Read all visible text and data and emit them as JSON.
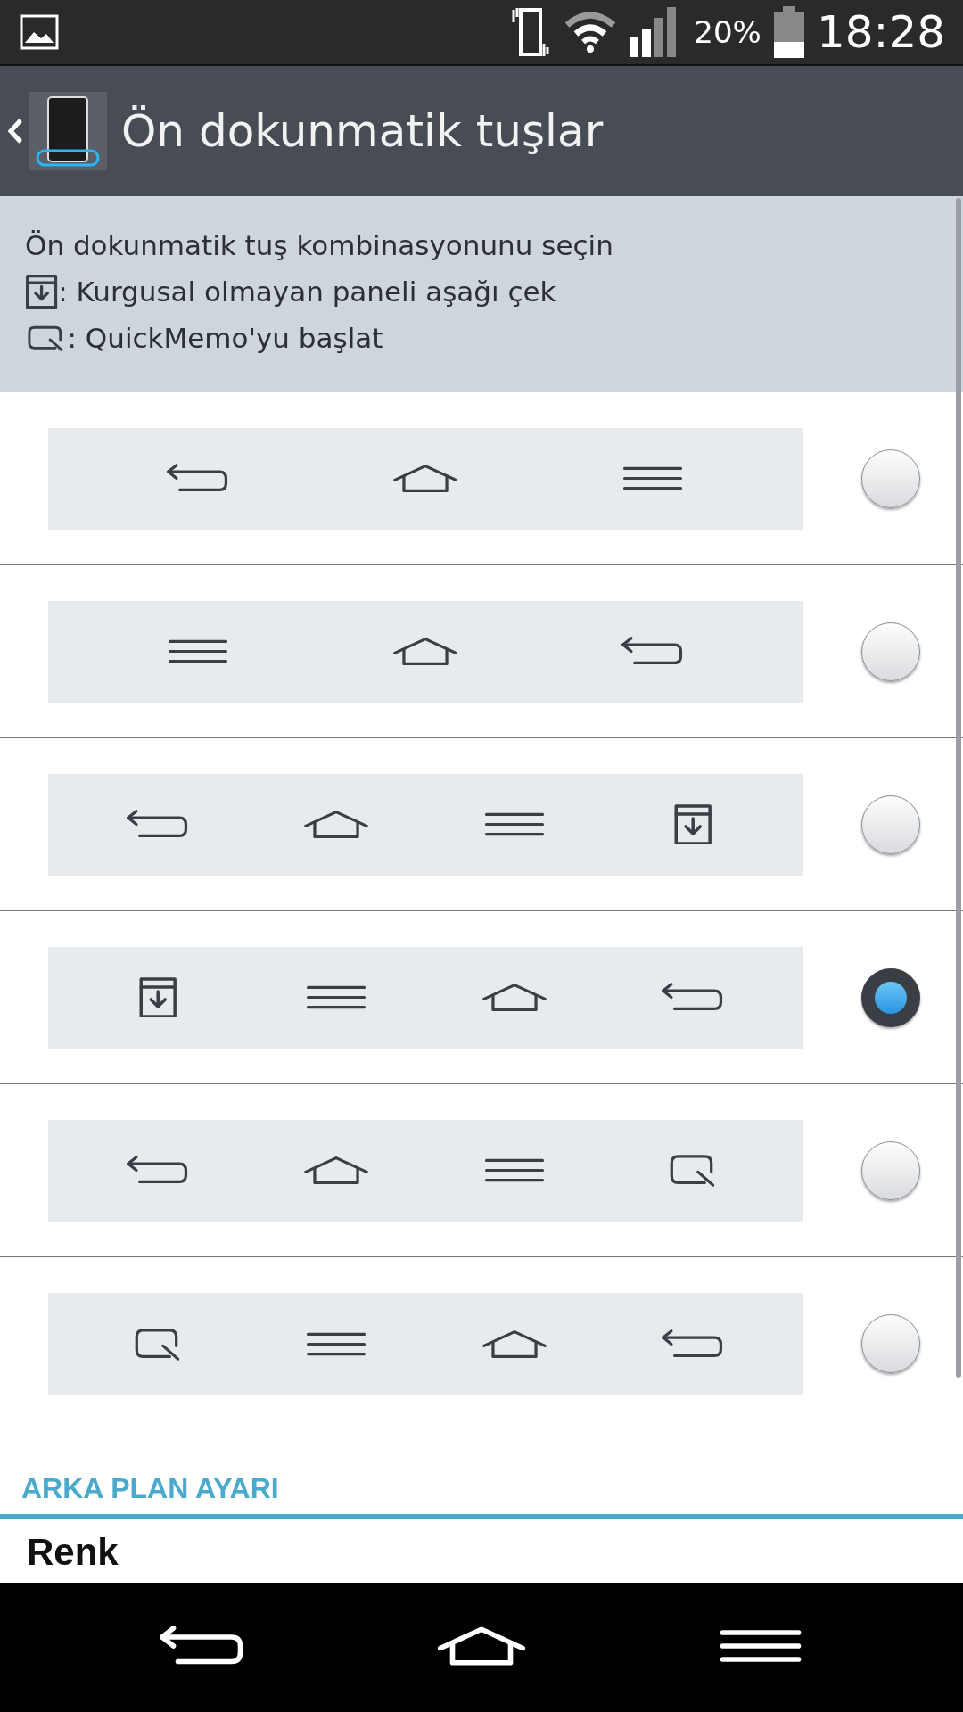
{
  "status_bar": {
    "battery": "20%",
    "time": "18:28"
  },
  "title_bar": {
    "title": "Ön dokunmatik tuşlar"
  },
  "info": {
    "heading": "Ön dokunmatik tuş kombinasyonunu seçin",
    "legend": [
      {
        "kind": "notif",
        "text": ": Kurgusal olmayan paneli aşağı çek"
      },
      {
        "kind": "memo",
        "text": ": QuickMemo'yu başlat"
      }
    ]
  },
  "options": [
    {
      "keys": [
        {
          "kind": "back"
        },
        {
          "kind": "home"
        },
        {
          "kind": "menu"
        }
      ],
      "selected": false
    },
    {
      "keys": [
        {
          "kind": "menu"
        },
        {
          "kind": "home"
        },
        {
          "kind": "back"
        }
      ],
      "selected": false
    },
    {
      "keys": [
        {
          "kind": "back"
        },
        {
          "kind": "home"
        },
        {
          "kind": "menu"
        },
        {
          "kind": "notif"
        }
      ],
      "selected": false
    },
    {
      "keys": [
        {
          "kind": "notif"
        },
        {
          "kind": "menu"
        },
        {
          "kind": "home"
        },
        {
          "kind": "back"
        }
      ],
      "selected": true
    },
    {
      "keys": [
        {
          "kind": "back"
        },
        {
          "kind": "home"
        },
        {
          "kind": "menu"
        },
        {
          "kind": "memo"
        }
      ],
      "selected": false
    },
    {
      "keys": [
        {
          "kind": "memo"
        },
        {
          "kind": "menu"
        },
        {
          "kind": "home"
        },
        {
          "kind": "back"
        }
      ],
      "selected": false
    }
  ],
  "section": {
    "header": "ARKA PLAN AYARI",
    "item": "Renk"
  },
  "nav_bar": [
    {
      "kind": "back"
    },
    {
      "kind": "home"
    },
    {
      "kind": "menu"
    }
  ]
}
